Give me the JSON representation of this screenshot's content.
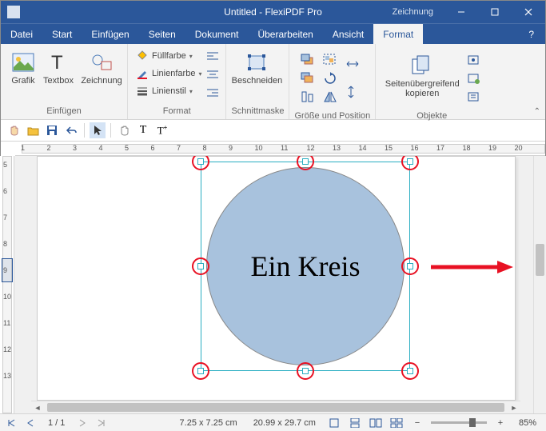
{
  "titlebar": {
    "title": "Untitled - FlexiPDF Pro",
    "context_tab": "Zeichnung"
  },
  "menu": {
    "tabs": [
      "Datei",
      "Start",
      "Einfügen",
      "Seiten",
      "Dokument",
      "Überarbeiten",
      "Ansicht",
      "Format"
    ],
    "active": 7,
    "help": "?"
  },
  "ribbon": {
    "groups": {
      "einfuegen": {
        "label": "Einfügen",
        "grafik": "Grafik",
        "textbox": "Textbox",
        "zeichnung": "Zeichnung"
      },
      "format_grp": {
        "label": "Format",
        "fuellfarbe": "Füllfarbe",
        "linienfarbe": "Linienfarbe",
        "linienstil": "Linienstil"
      },
      "schnittmaske": {
        "label": "Schnittmaske",
        "beschneiden": "Beschneiden"
      },
      "groesse": {
        "label": "Größe und Position"
      },
      "objekte": {
        "label": "Objekte",
        "seitenueb": "Seitenübergreifend kopieren"
      }
    }
  },
  "ruler_h_labels": [
    "1",
    "2",
    "3",
    "4",
    "5",
    "6",
    "7",
    "8",
    "9",
    "10",
    "11",
    "12",
    "13",
    "14",
    "15",
    "16",
    "17",
    "18",
    "19",
    "20"
  ],
  "ruler_v_labels": [
    "5",
    "6",
    "7",
    "8",
    "9",
    "10",
    "11",
    "12",
    "13"
  ],
  "shape_text": "Ein Kreis",
  "status": {
    "page": "1 / 1",
    "sel_size": "7.25 x 7.25 cm",
    "doc_size": "20.99 x 29.7 cm",
    "zoom": "85%"
  }
}
